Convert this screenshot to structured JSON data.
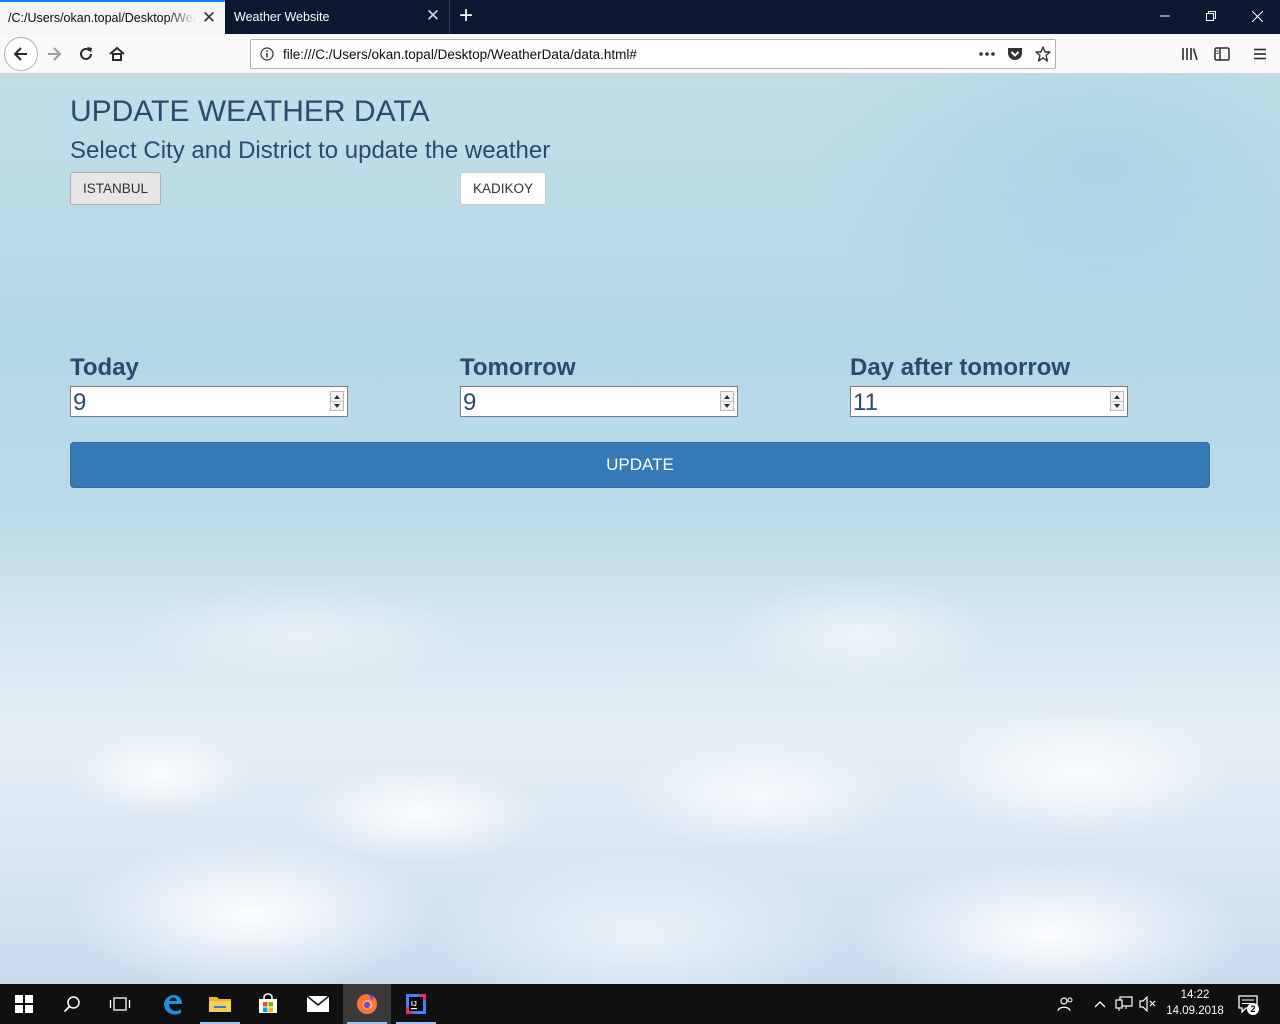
{
  "browser": {
    "tabs": [
      {
        "title": "/C:/Users/okan.topal/Desktop/Weat",
        "active": true
      },
      {
        "title": "Weather Website",
        "active": false
      }
    ],
    "url": "file:///C:/Users/okan.topal/Desktop/WeatherData/data.html#",
    "accent_color": "#0a84ff"
  },
  "page": {
    "title": "UPDATE WEATHER DATA",
    "subtitle": "Select City and District to update the weather",
    "city_button": "ISTANBUL",
    "district_button": "KADIKOY",
    "days": [
      {
        "label": "Today",
        "value": "9"
      },
      {
        "label": "Tomorrow",
        "value": "9"
      },
      {
        "label": "Day after tomorrow",
        "value": "11"
      }
    ],
    "update_button": "UPDATE",
    "heading_color": "#2c4a6b",
    "button_color": "#337ab7"
  },
  "taskbar": {
    "apps": [
      "windows-start-icon",
      "search-icon",
      "task-view-icon",
      "edge-icon",
      "file-explorer-icon",
      "store-icon",
      "mail-icon",
      "firefox-icon",
      "intellij-icon"
    ],
    "time": "14:22",
    "date": "14.09.2018",
    "notification_count": "2"
  }
}
